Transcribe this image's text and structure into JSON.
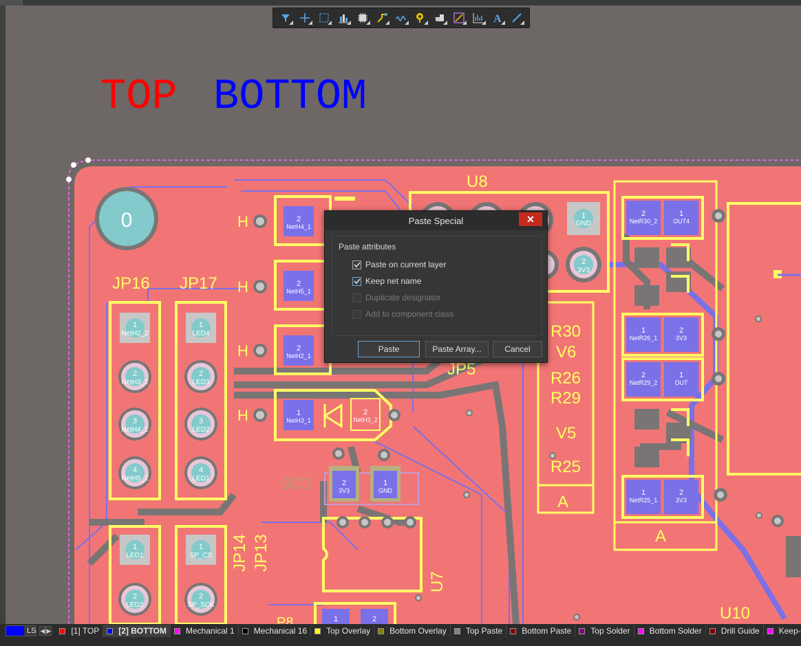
{
  "canvas_labels": {
    "top": "TOP",
    "bottom": "BOTTOM",
    "u8": "U8",
    "jp16": "JP16",
    "jp17": "JP17",
    "jp5": "JP5",
    "jp14": "JP14",
    "jp13": "JP13",
    "u7": "U7",
    "u10": "U10",
    "c26": "C26",
    "r30": "R30",
    "v6": "V6",
    "r26": "R26",
    "r29": "R29",
    "v5": "V5",
    "r25": "R25",
    "a": "A",
    "h": "H",
    "hole": "0",
    "p8": "P8"
  },
  "pads": {
    "jp16": [
      "NetH2_2",
      "NetH3_2",
      "NetH4_2",
      "NetH5_2"
    ],
    "jp17": [
      "LED4",
      "LED3",
      "LED2",
      "LED1"
    ],
    "u8": [
      "GND",
      "3V3"
    ],
    "d_left": [
      "NetH4_1",
      "NetH5_1",
      "NetH2_1",
      "NetH3_1"
    ],
    "d_right": "NetH3_2",
    "c26": [
      "3V3",
      "GND"
    ],
    "r30": [
      "NetR30_2",
      "OUT4"
    ],
    "r26": [
      "NetR26_1",
      "3V3"
    ],
    "r29": [
      "NetR29_2",
      "OUT"
    ],
    "r25": [
      "NetR25_1",
      "3V3"
    ],
    "jp14": [
      "LED1",
      "LED2"
    ],
    "jp13": [
      "SP_CS",
      "SP_SCK"
    ]
  },
  "toolbar": [
    {
      "name": "filter-icon"
    },
    {
      "name": "cross-icon"
    },
    {
      "name": "select-rect-icon"
    },
    {
      "name": "align-icon"
    },
    {
      "name": "component-icon"
    },
    {
      "name": "route-icon"
    },
    {
      "name": "tune-icon"
    },
    {
      "name": "via-icon"
    },
    {
      "name": "polygon-icon"
    },
    {
      "name": "dimension-icon"
    },
    {
      "name": "chart-icon"
    },
    {
      "name": "text-icon"
    },
    {
      "name": "line-icon"
    }
  ],
  "dialog": {
    "title": "Paste Special",
    "close": "✕",
    "group_title": "Paste attributes",
    "options": [
      {
        "label": "Paste on current layer",
        "checked": true,
        "enabled": true
      },
      {
        "label": "Keep net name",
        "checked": true,
        "enabled": true
      },
      {
        "label": "Duplicate designator",
        "checked": false,
        "enabled": false
      },
      {
        "label": "Add to component class",
        "checked": false,
        "enabled": false
      }
    ],
    "buttons": {
      "paste": "Paste",
      "paste_array": "Paste Array...",
      "cancel": "Cancel"
    }
  },
  "layerbar": {
    "ls_label": "LS",
    "ls_color": "#0000ff",
    "prev": "◀",
    "next": "▶",
    "layers": [
      {
        "label": "[1] TOP",
        "color": "#ff0000",
        "active": false
      },
      {
        "label": "[2] BOTTOM",
        "color": "#0000ff",
        "active": true
      },
      {
        "label": "Mechanical 1",
        "color": "#ff00ff",
        "active": false
      },
      {
        "label": "Mechanical 16",
        "color": "#000000",
        "active": false
      },
      {
        "label": "Top Overlay",
        "color": "#ffff00",
        "active": false
      },
      {
        "label": "Bottom Overlay",
        "color": "#808000",
        "active": false
      },
      {
        "label": "Top Paste",
        "color": "#808080",
        "active": false
      },
      {
        "label": "Bottom Paste",
        "color": "#800000",
        "active": false
      },
      {
        "label": "Top Solder",
        "color": "#800080",
        "active": false
      },
      {
        "label": "Bottom Solder",
        "color": "#ff00ff",
        "active": false
      },
      {
        "label": "Drill Guide",
        "color": "#800000",
        "active": false
      },
      {
        "label": "Keep-",
        "color": "#ff00ff",
        "active": false
      }
    ]
  }
}
